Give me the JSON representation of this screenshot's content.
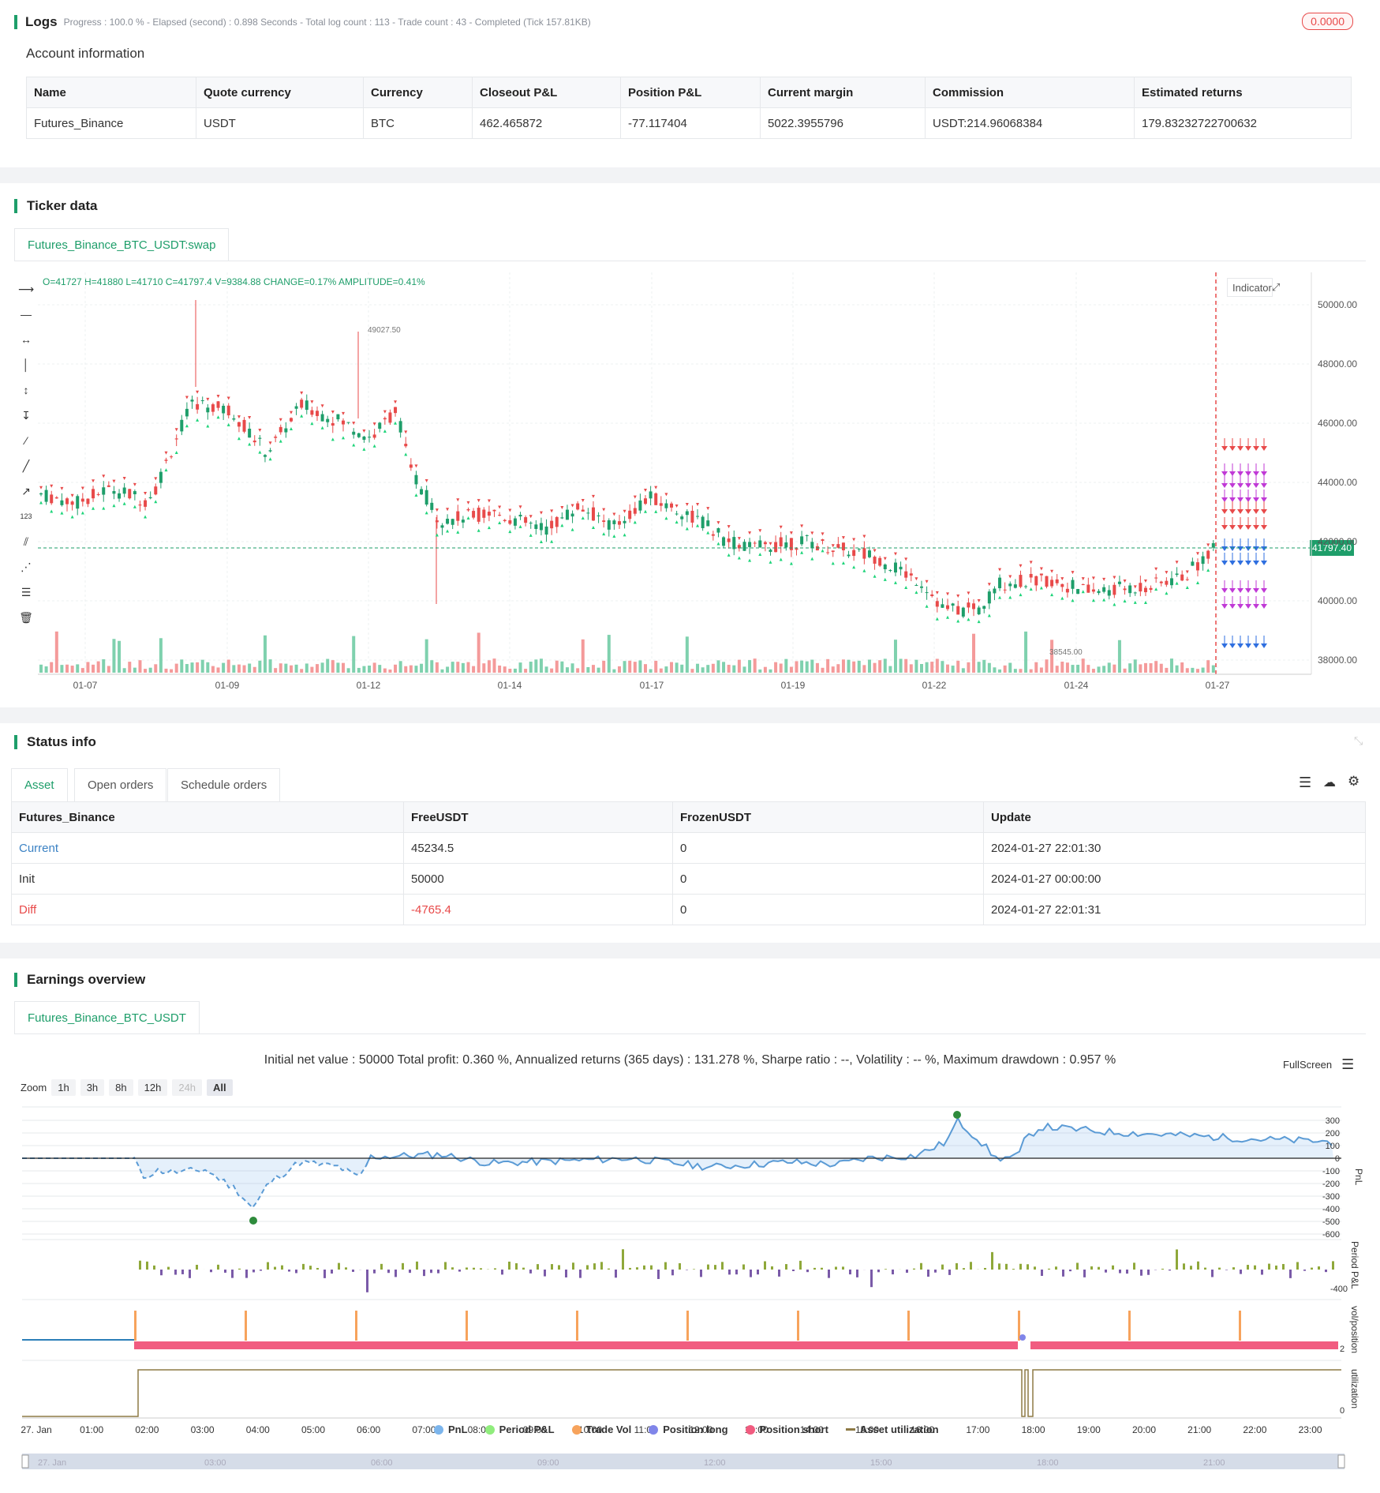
{
  "logs": {
    "title": "Logs",
    "meta": "Progress : 100.0 % - Elapsed (second) : 0.898  Seconds - Total log count : 113 - Trade count : 43 - Completed (Tick 157.81KB)",
    "badge": "0.0000"
  },
  "account": {
    "label": "Account information",
    "headers": [
      "Name",
      "Quote currency",
      "Currency",
      "Closeout P&L",
      "Position P&L",
      "Current margin",
      "Commission",
      "Estimated returns"
    ],
    "row": [
      "Futures_Binance",
      "USDT",
      "BTC",
      "462.465872",
      "-77.117404",
      "5022.3955796",
      "USDT:214.96068384",
      "179.83232722700632"
    ]
  },
  "ticker": {
    "title": "Ticker data",
    "tab": "Futures_Binance_BTC_USDT:swap",
    "ohlc": "O=41727 H=41880 L=41710 C=41797.4 V=9384.88 CHANGE=0.17% AMPLITUDE=0.41%",
    "indicator_label": "Indicator",
    "price_labels": [
      "50000.00",
      "48000.00",
      "46000.00",
      "44000.00",
      "42000.00",
      "40000.00",
      "38000.00"
    ],
    "date_labels": [
      "01-07",
      "01-09",
      "01-12",
      "01-14",
      "01-17",
      "01-19",
      "01-22",
      "01-24",
      "01-27"
    ],
    "last_price": "41797.40",
    "high_mark": "49027.50",
    "low_mark": "38545.00",
    "tools": [
      "ray-icon",
      "h-line-icon",
      "h-segment-icon",
      "v-line-icon",
      "v-segment-icon",
      "v-ray-icon",
      "trend-line-icon",
      "segment-icon",
      "arrow-line-icon",
      "price-label-icon",
      "parallel-channel-icon",
      "fib-icon",
      "horizontal-lines-icon",
      "trash-icon"
    ]
  },
  "status": {
    "title": "Status info",
    "tabs": [
      "Asset",
      "Open orders",
      "Schedule orders"
    ],
    "headers": [
      "Futures_Binance",
      "FreeUSDT",
      "FrozenUSDT",
      "Update"
    ],
    "rows": [
      [
        "Current",
        "45234.5",
        "0",
        "2024-01-27 22:01:30"
      ],
      [
        "Init",
        "50000",
        "0",
        "2024-01-27 00:00:00"
      ],
      [
        "Diff",
        "-4765.4",
        "0",
        "2024-01-27 22:01:31"
      ]
    ]
  },
  "earnings": {
    "title": "Earnings overview",
    "tab": "Futures_Binance_BTC_USDT",
    "summary": "Initial net value : 50000 Total profit: 0.360 %, Annualized returns (365 days) : 131.278 %, Sharpe ratio : --, Volatility : -- %, Maximum drawdown : 0.957 %",
    "fullscreen": "FullScreen",
    "zoom_label": "Zoom",
    "zoom_buttons": [
      "1h",
      "3h",
      "8h",
      "12h",
      "24h",
      "All"
    ],
    "pnl_ticks": [
      "300",
      "200",
      "100",
      "0",
      "-100",
      "-200",
      "-300",
      "-400",
      "-500",
      "-600"
    ],
    "period_tick": "-400",
    "pos_tick": "2",
    "util_tick": "0",
    "axis_names": [
      "PnL",
      "Period P&L",
      "vol/position",
      "utilization"
    ],
    "time_labels": [
      "27. Jan",
      "01:00",
      "02:00",
      "03:00",
      "04:00",
      "05:00",
      "06:00",
      "07:00",
      "08:00",
      "09:00",
      "10:00",
      "11:00",
      "12:00",
      "13:00",
      "14:00",
      "15:00",
      "16:00",
      "17:00",
      "18:00",
      "19:00",
      "20:00",
      "21:00",
      "22:00",
      "23:00"
    ],
    "nav_labels": [
      "27. Jan",
      "03:00",
      "06:00",
      "09:00",
      "12:00",
      "15:00",
      "18:00",
      "21:00"
    ],
    "legend": [
      {
        "label": "PnL",
        "color": "#7cb5ec"
      },
      {
        "label": "Period P&L",
        "color": "#90ed7d"
      },
      {
        "label": "Trade Vol",
        "color": "#f7a35c"
      },
      {
        "label": "Position long",
        "color": "#8085e9"
      },
      {
        "label": "Position short",
        "color": "#f15c80"
      },
      {
        "label": "Asset utilization",
        "color": "#8d7a45"
      }
    ]
  }
}
